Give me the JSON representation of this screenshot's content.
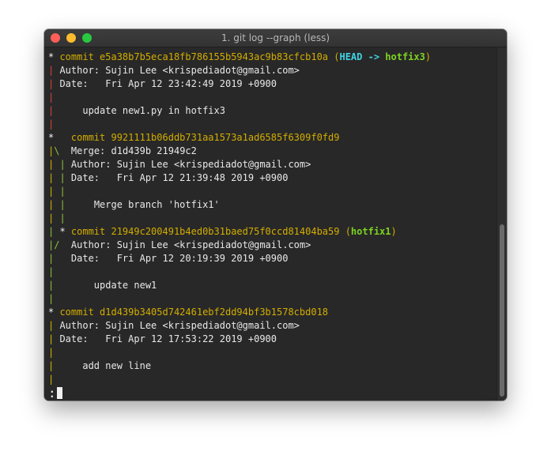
{
  "window": {
    "title": "1. git log --graph (less)"
  },
  "log": {
    "c1": {
      "graph": "* ",
      "label": "commit ",
      "hash": "e5a38b7b5eca18fb786155b5943ac9b83cfcb10a",
      "ref_open": " (",
      "head": "HEAD -> ",
      "branch": "hotfix3",
      "ref_close": ")",
      "author": "Author: Sujin Lee <krispediadot@gmail.com>",
      "date": "Date:   Fri Apr 12 23:42:49 2019 +0900",
      "message": "update new1.py in hotfix3"
    },
    "c2": {
      "graph": "*   ",
      "label": "commit ",
      "hash": "9921111b06ddb731aa1573a1ad6585f6309f0fd9",
      "merge": "Merge: d1d439b 21949c2",
      "author": "Author: Sujin Lee <krispediadot@gmail.com>",
      "date": "Date:   Fri Apr 12 21:39:48 2019 +0900",
      "message": "Merge branch 'hotfix1'"
    },
    "c3": {
      "graph_pipe": "| ",
      "graph_star": "* ",
      "label": "commit ",
      "hash": "21949c200491b4ed0b31baed75f0ccd81404ba59",
      "ref_open": " (",
      "branch": "hotfix1",
      "ref_close": ")",
      "author": "Author: Sujin Lee <krispediadot@gmail.com>",
      "date": "Date:   Fri Apr 12 20:19:39 2019 +0900",
      "message": "update new1"
    },
    "c4": {
      "graph": "* ",
      "label": "commit ",
      "hash": "d1d439b3405d742461ebf2dd94bf3b1578cbd018",
      "author": "Author: Sujin Lee <krispediadot@gmail.com>",
      "date": "Date:   Fri Apr 12 17:53:22 2019 +0900",
      "message": "add new line"
    },
    "prompt": ":"
  },
  "colors": {
    "terminal_bg": "#282828",
    "hash": "#d3ad00",
    "head": "#3fd3e2",
    "branch": "#7ed321",
    "graph_red": "#e0443c",
    "graph_green": "#8ec43d",
    "graph_yellow": "#d6b600"
  }
}
